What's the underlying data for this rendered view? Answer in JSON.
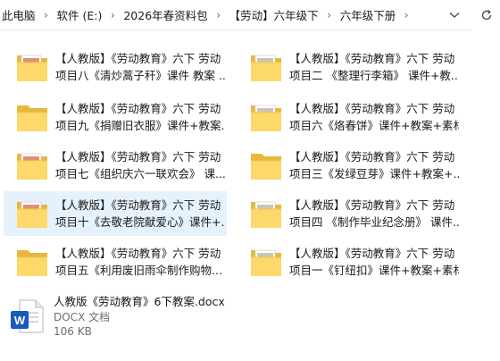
{
  "breadcrumb": [
    "此电脑",
    "软件 (E:)",
    "2026年春资料包",
    "【劳动】六年级下",
    "六年级下册"
  ],
  "items": [
    {
      "line1": "【人教版】《劳动教育》六下 劳动",
      "line2": "项目八《清炒蒿子秆》课件 教案 ..."
    },
    {
      "line1": "【人教版】《劳动教育》六下 劳动",
      "line2": "项目二 《整理行李箱》 课件+教..."
    },
    {
      "line1": "【人教版】《劳动教育》六下 劳动",
      "line2": "项目九《捐赠旧衣服》课件+教案..."
    },
    {
      "line1": "【人教版】《劳动教育》六下 劳动",
      "line2": "项目六《烙春饼》课件+教案+素材"
    },
    {
      "line1": "【人教版】《劳动教育》六下 劳动",
      "line2": "项目七《组织庆六一联欢会》 课..."
    },
    {
      "line1": "【人教版】《劳动教育》六下 劳动",
      "line2": "项目三《发绿豆芽》课件+教案+..."
    },
    {
      "line1": "【人教版】《劳动教育》六下 劳动",
      "line2": "项目十《去敬老院献爱心》课件+..."
    },
    {
      "line1": "【人教版】《劳动教育》六下 劳动",
      "line2": "项目四 《制作毕业纪念册》 课件..."
    },
    {
      "line1": "【人教版】《劳动教育》六下 劳动",
      "line2": "项目五《利用废旧雨伞制作购物..."
    },
    {
      "line1": "【人教版】《劳动教育》六下 劳动",
      "line2": "项目一《钉纽扣》课件+教案+素材"
    }
  ],
  "document": {
    "name": "人教版《劳动教育》6下教案.docx",
    "type": "DOCX 文档",
    "size": "106 KB",
    "icon_letter": "W"
  },
  "colors": {
    "folder_back": "#e8b73c",
    "folder_front": "#fcd96a",
    "selected_bg": "#e5f1fb",
    "word_blue": "#185abd"
  }
}
